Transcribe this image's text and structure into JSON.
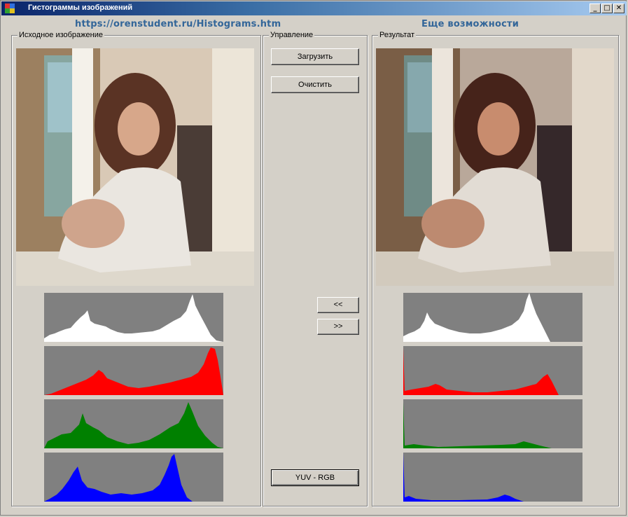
{
  "window": {
    "title": "Гистограммы изображений",
    "controls": {
      "minimize": "_",
      "maximize": "□",
      "close": "✕"
    }
  },
  "links": {
    "url": "https://orenstudent.ru/Histograms.htm",
    "more": "Еще возможности"
  },
  "groups": {
    "source": "Исходное изображение",
    "control": "Управление",
    "result": "Результат"
  },
  "buttons": {
    "load": "Загрузить",
    "clear": "Очистить",
    "back": "<<",
    "forward": ">>",
    "yuv": "YUV - RGB"
  },
  "colors": {
    "luma": "#ffffff",
    "red": "#ff0000",
    "green": "#008000",
    "blue": "#0000ff",
    "hist_bg": "#808080",
    "link": "#336699"
  }
}
